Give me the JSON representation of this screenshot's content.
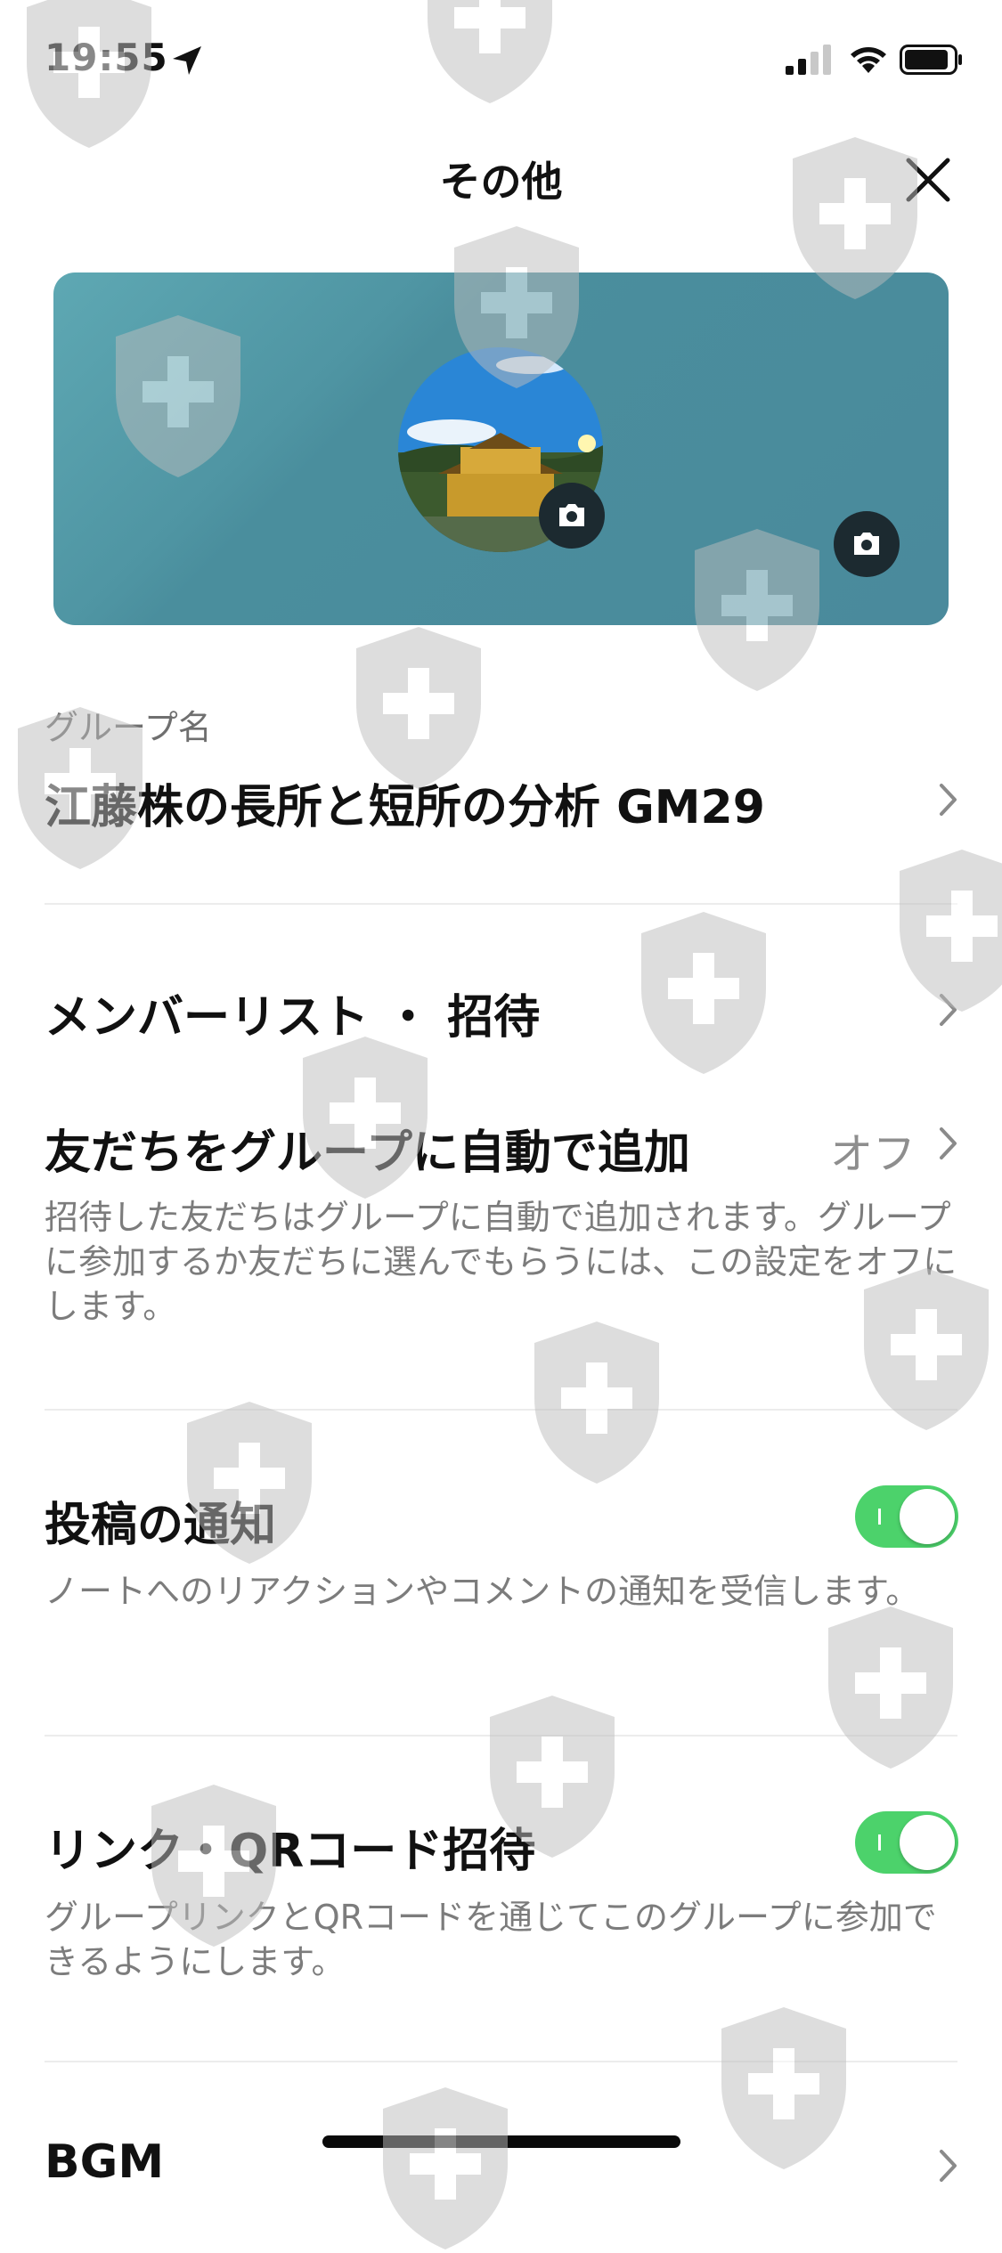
{
  "status_bar": {
    "time": "19:55"
  },
  "header": {
    "title": "その他"
  },
  "group": {
    "label": "グループ名",
    "name": "江藤株の長所と短所の分析 GM29"
  },
  "rows": {
    "member_list": {
      "title": "メンバーリスト ・ 招待"
    },
    "auto_add": {
      "title": "友だちをグループに自動で追加",
      "value": "オフ",
      "desc": "招待した友だちはグループに自動で追加されます。グループに参加するか友だちに選んでもらうには、この設定をオフにします。"
    },
    "post_notify": {
      "title": "投稿の通知",
      "desc": "ノートへのリアクションやコメントの通知を受信します。",
      "enabled": true
    },
    "link_qr": {
      "title": "リンク・QRコード招待",
      "desc": "グループリンクとQRコードを通じてこのグループに参加できるようにします。",
      "enabled": true
    },
    "bgm": {
      "title": "BGM"
    }
  },
  "colors": {
    "toggle_on": "#4cd26b",
    "cover_bg": "#4a8a9c"
  },
  "icons": [
    "location-arrow-icon",
    "cellular-signal-icon",
    "wifi-icon",
    "battery-icon",
    "close-icon",
    "camera-icon",
    "chevron-right-icon",
    "shield-watermark-icon"
  ]
}
